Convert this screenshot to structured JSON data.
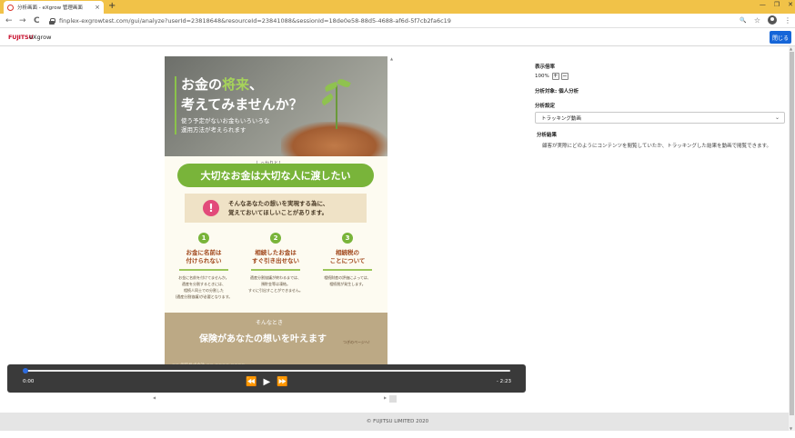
{
  "browser": {
    "tab_title": "分析画面 - eXgrow 管理画面",
    "tab_close": "×",
    "new_tab": "+",
    "url": "finplex-exgrowtest.com/gui/analyze?userId=23818648&resourceId=23841088&sessionId=18de0e58-88d5-4688-af6d-5f7cb2fa6c19",
    "back": "←",
    "forward": "→",
    "reload": "C",
    "search_glyph": "🔍",
    "star_glyph": "☆",
    "menu_glyph": "⋮",
    "win_min": "—",
    "win_max": "❐",
    "win_close": "✕"
  },
  "app": {
    "brand": "FUJITSU",
    "name": "eXgrow",
    "close_label": "閉じる"
  },
  "poster": {
    "headline_1a": "お金の",
    "headline_1b": "将来",
    "headline_1c": "、",
    "headline_2": "考えてみませんか？",
    "sub_1": "使う予定がないお金もいろいろな",
    "sub_2": "運用方法が考えられます",
    "ribbon_small": "しっかりと！",
    "ribbon": "大切なお金は大切な人に渡したい",
    "alert_mark": "!",
    "alert_1": "そんなあなたの想いを実現する為に、",
    "alert_2": "覚えておいてほしいことがあります。",
    "columns": [
      {
        "num": "1",
        "title": "お金に名前は\n付けられない",
        "body": "お金に名前を付けてませんか。\n遺産を分割するときには、\n相続人同士での分割した\n(遺産分割協議)が必要となります。"
      },
      {
        "num": "2",
        "title": "相続したお金は\nすぐ引き出せない",
        "body": "遺産分割協議が終わるまでは、\n預貯金等は凍結。\nすぐに引出すことができません。"
      },
      {
        "num": "3",
        "title": "相続税の\nことについて",
        "body": "相続財産の評価によっては、\n相続税が発生します。"
      }
    ],
    "soon": "そんなとき",
    "final": "保険があなたの想いを叶えます",
    "final_note": "つぎのページへ！",
    "footer_line": "○○ 保険株式会社   ○○-○○○○-○○○○"
  },
  "scrollbars": {
    "up": "▲",
    "down": "▼",
    "left": "◀",
    "right": "▶"
  },
  "panel": {
    "zoom_label": "表示倍率",
    "zoom_value": "100%",
    "zoom_in": "+",
    "zoom_out": "−",
    "target": "分析対象: 個人分析",
    "setting_label": "分析設定",
    "setting_value": "トラッキング動画",
    "setting_arrow": "⌄",
    "result_label": "分析結果",
    "result_desc": "顧客が実際にどのようにコンテンツを閲覧していたか、トラッキングした結果を動画で閲覧できます。"
  },
  "player": {
    "current": "0:00",
    "remaining": "- 2:23",
    "progress": 0,
    "rewind": "⏪",
    "play": "▶",
    "forward": "⏩"
  },
  "footer": {
    "copyright": "© FUJITSU LIMITED 2020"
  },
  "colors": {
    "tab_bar": "#f1c248",
    "accent_blue": "#1565d8",
    "brand_red": "#c8102e",
    "poster_green": "#79b43a",
    "player_bg": "#3a3a3a"
  }
}
